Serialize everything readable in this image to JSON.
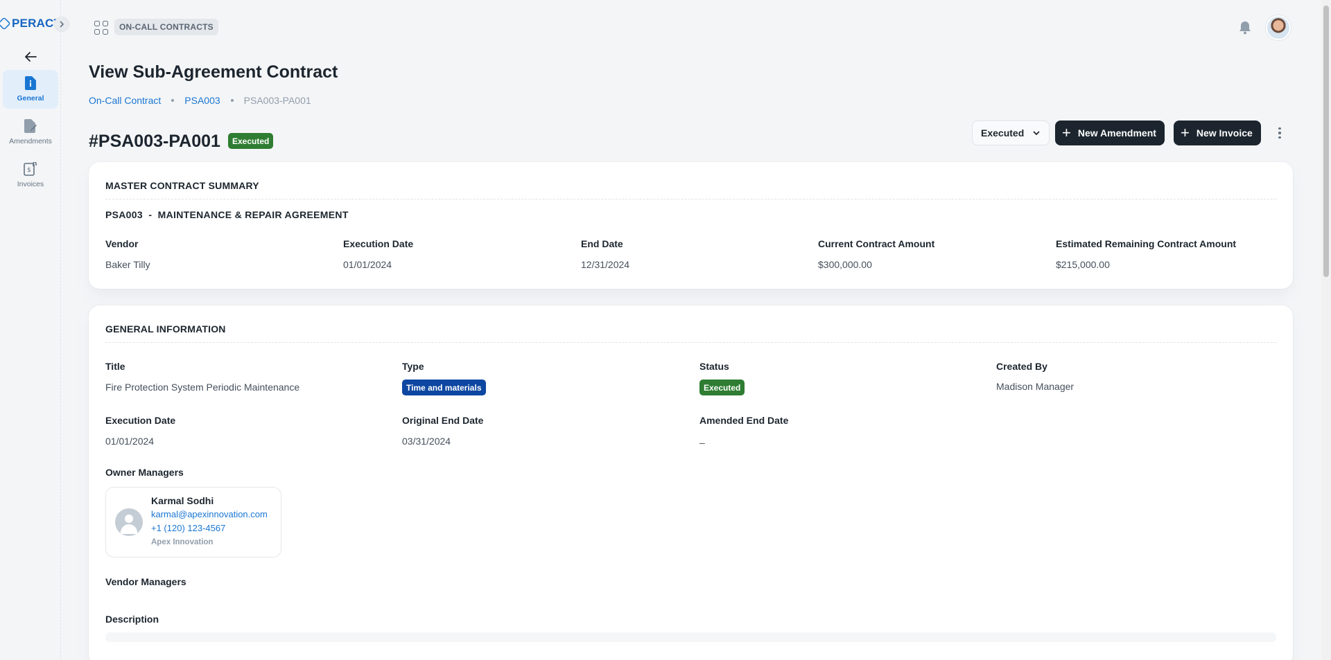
{
  "app": {
    "logo_text": "PERACT"
  },
  "sidebar": {
    "items": [
      {
        "label": "General",
        "active": true
      },
      {
        "label": "Amendments",
        "active": false
      },
      {
        "label": "Invoices",
        "active": false
      }
    ]
  },
  "header": {
    "module": "ON-CALL CONTRACTS"
  },
  "page": {
    "title": "View Sub-Agreement Contract",
    "breadcrumb": [
      "On-Call Contract",
      "PSA003",
      "PSA003-PA001"
    ],
    "contract_id": "#PSA003-PA001",
    "status_badge": "Executed"
  },
  "actions": {
    "status_select": "Executed",
    "new_amendment": "New Amendment",
    "new_invoice": "New Invoice"
  },
  "master_summary": {
    "heading": "MASTER CONTRACT SUMMARY",
    "subheading": "PSA003  -  MAINTENANCE & REPAIR AGREEMENT",
    "fields": [
      {
        "label": "Vendor",
        "value": "Baker Tilly"
      },
      {
        "label": "Execution Date",
        "value": "01/01/2024"
      },
      {
        "label": "End Date",
        "value": "12/31/2024"
      },
      {
        "label": "Current Contract Amount",
        "value": "$300,000.00"
      },
      {
        "label": "Estimated Remaining Contract Amount",
        "value": "$215,000.00"
      }
    ]
  },
  "general_info": {
    "heading": "GENERAL INFORMATION",
    "title_label": "Title",
    "title_value": "Fire Protection System Periodic Maintenance",
    "type_label": "Type",
    "type_value": "Time and materials",
    "status_label": "Status",
    "status_value": "Executed",
    "created_by_label": "Created By",
    "created_by_value": "Madison Manager",
    "execution_date_label": "Execution Date",
    "execution_date_value": "01/01/2024",
    "original_end_label": "Original End Date",
    "original_end_value": "03/31/2024",
    "amended_end_label": "Amended End Date",
    "amended_end_value": "–",
    "owner_managers_label": "Owner Managers",
    "owner_manager": {
      "name": "Karmal Sodhi",
      "email": "karmal@apexinnovation.com",
      "phone": "+1 (120) 123-4567",
      "company": "Apex Innovation"
    },
    "vendor_managers_label": "Vendor Managers",
    "description_label": "Description"
  },
  "colors": {
    "accent": "#1976d2",
    "dark_button": "#1c252e",
    "executed_badge": "#2e7d32",
    "type_badge": "#0d47a1"
  }
}
